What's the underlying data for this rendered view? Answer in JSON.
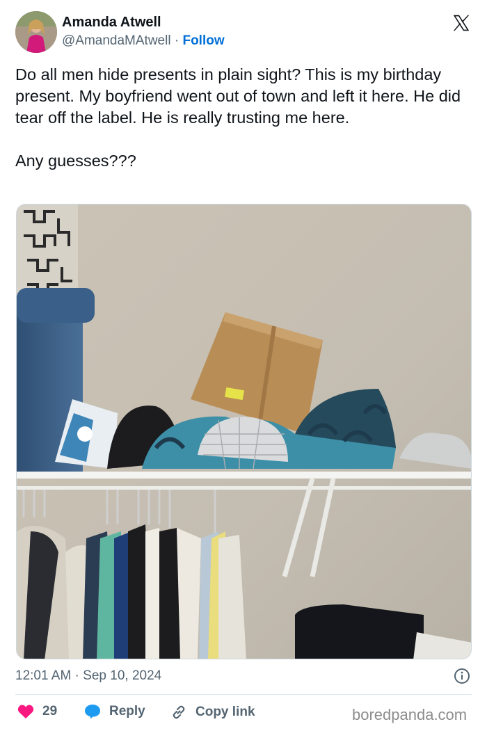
{
  "author": {
    "name": "Amanda Atwell",
    "handle": "@AmandaMAtwell",
    "separator": "·",
    "follow_label": "Follow"
  },
  "tweet": {
    "text": "Do all men hide presents in plain sight? This is my birthday present. My boyfriend went out of town and left it here. He did tear off the label. He is really trusting me here.\n\nAny guesses???",
    "timestamp": "12:01 AM · Sep 10, 2024"
  },
  "actions": {
    "like_count": "29",
    "reply_label": "Reply",
    "copy_label": "Copy link"
  },
  "watermark": "boredpanda.com",
  "colors": {
    "like": "#f91880",
    "reply": "#1d9bf0",
    "follow": "#006fd6",
    "secondary_text": "#536471"
  },
  "icons": [
    "x-logo-icon",
    "info-icon",
    "heart-icon",
    "reply-bubble-icon",
    "link-icon"
  ]
}
